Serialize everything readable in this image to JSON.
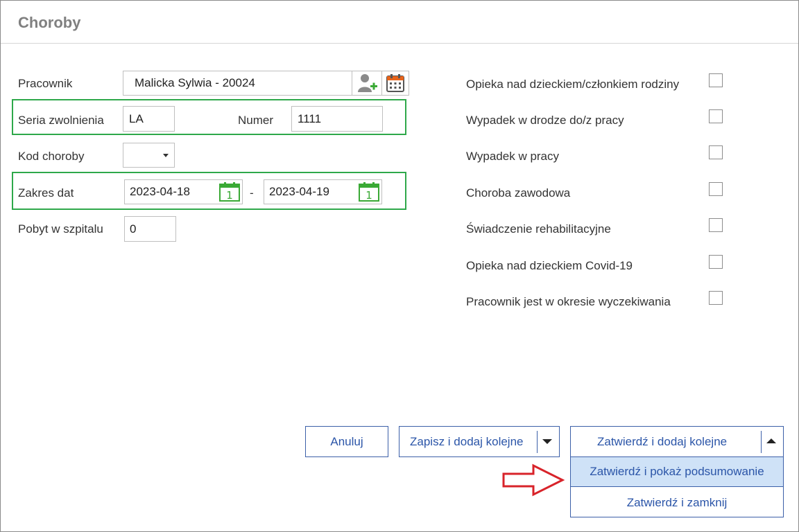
{
  "window": {
    "title": "Choroby"
  },
  "form": {
    "pracownik_label": "Pracownik",
    "pracownik_value": "Malicka Sylwia - 20024",
    "seria_label": "Seria zwolnienia",
    "seria_value": "LA",
    "numer_label": "Numer",
    "numer_value": "1111",
    "kod_label": "Kod choroby",
    "kod_value": "",
    "zakres_label": "Zakres dat",
    "date_from": "2023-04-18",
    "date_separator": "-",
    "date_to": "2023-04-19",
    "calendar_day": "1",
    "pobyt_label": "Pobyt w szpitalu",
    "pobyt_value": "0"
  },
  "checkboxes": [
    {
      "label": "Opieka nad dzieckiem/członkiem rodziny",
      "checked": false
    },
    {
      "label": "Wypadek w drodze do/z pracy",
      "checked": false
    },
    {
      "label": "Wypadek w pracy",
      "checked": false
    },
    {
      "label": "Choroba zawodowa",
      "checked": false
    },
    {
      "label": "Świadczenie rehabilitacyjne",
      "checked": false
    },
    {
      "label": "Opieka nad dzieckiem Covid-19",
      "checked": false
    },
    {
      "label": "Pracownik jest w okresie wyczekiwania",
      "checked": false
    }
  ],
  "buttons": {
    "cancel": "Anuluj",
    "save_add": "Zapisz i dodaj kolejne",
    "confirm_add": "Zatwierdź i dodaj kolejne"
  },
  "dropdown": {
    "items": [
      "Zatwierdź i pokaż podsumowanie",
      "Zatwierdź i zamknij"
    ],
    "highlighted_index": 0
  },
  "colors": {
    "highlight_box": "#2ea84a",
    "button_border": "#3b5fa8",
    "button_text": "#2b55a8",
    "dropdown_highlight": "#cfe2f7",
    "annotation_arrow": "#d8232a",
    "calendar_icon": "#3aa935",
    "add_user_icon_plus": "#3aa935",
    "schedule_icon": "#e8641b"
  }
}
